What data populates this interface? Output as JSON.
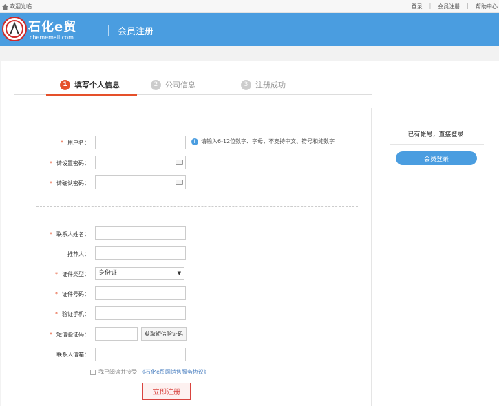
{
  "topbar": {
    "welcome": "欢迎光临",
    "links": [
      "登录",
      "会员注册",
      "帮助中心"
    ]
  },
  "header": {
    "logo_title": "石化e贸",
    "logo_sub": "chememall.com",
    "page_title": "会员注册"
  },
  "steps": [
    {
      "num": "1",
      "label": "填写个人信息",
      "active": true
    },
    {
      "num": "2",
      "label": "公司信息",
      "active": false
    },
    {
      "num": "3",
      "label": "注册成功",
      "active": false
    }
  ],
  "form": {
    "username_label": "用户名：",
    "username_hint": "请输入6-12位数字、字母，不支持中文、符号和纯数字",
    "password_label": "请设置密码：",
    "confirm_label": "请确认密码：",
    "contact_name_label": "联系人姓名：",
    "referrer_label": "推荐人：",
    "id_type_label": "证件类型：",
    "id_type_value": "身份证",
    "id_number_label": "证件号码：",
    "phone_label": "验证手机：",
    "sms_label": "短信验证码：",
    "sms_button": "获取短信验证码",
    "email_label": "联系人信箱：",
    "agree_text": "我已阅读并接受",
    "agree_link": "《石化e贸网销售服务协议》",
    "submit": "立即注册"
  },
  "right_panel": {
    "title": "已有帐号，直接登录",
    "login_button": "会员登录"
  },
  "colors": {
    "header": "#4a9de0",
    "accent": "#e5502a"
  }
}
